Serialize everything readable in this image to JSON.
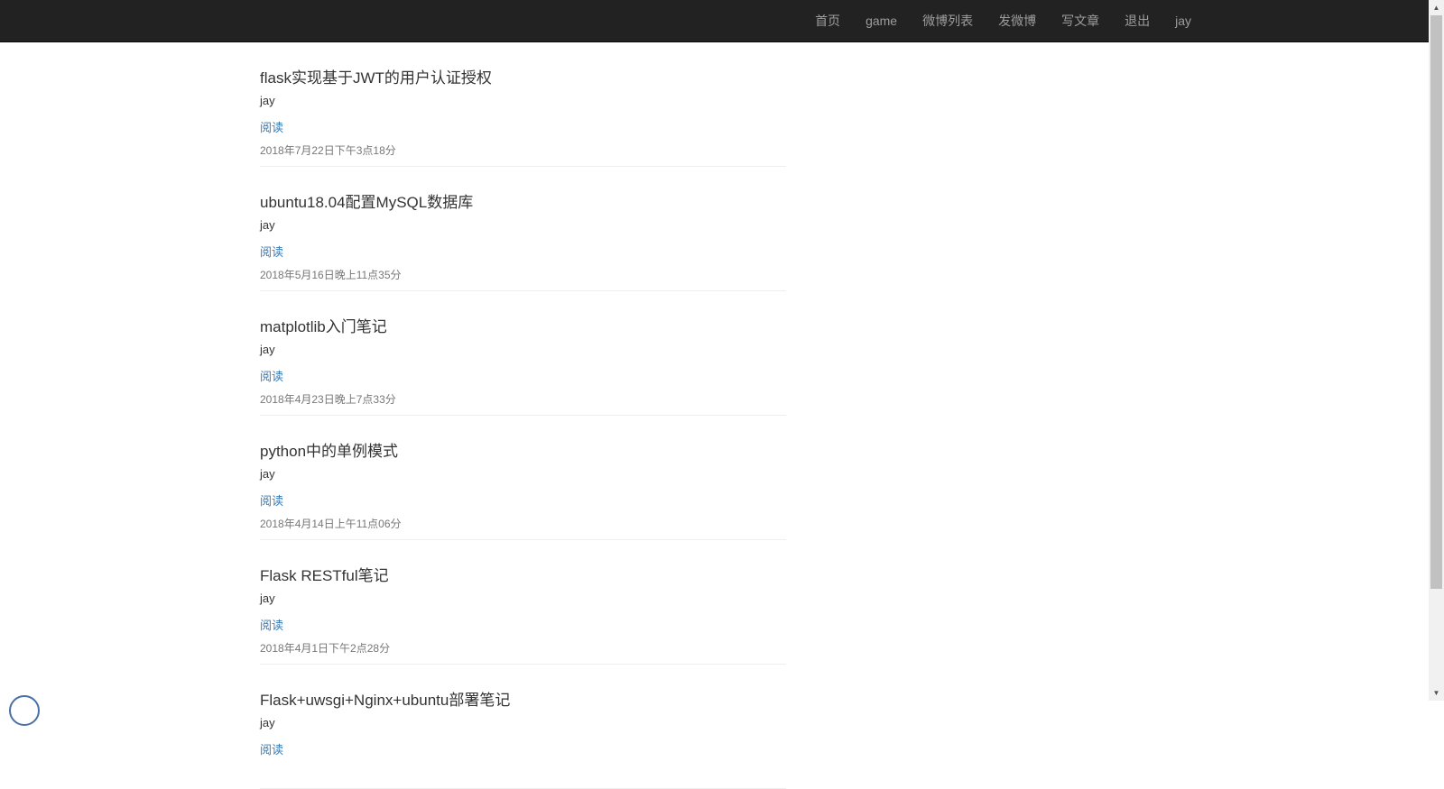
{
  "navbar": {
    "items": [
      {
        "label": "首页"
      },
      {
        "label": "game"
      },
      {
        "label": "微博列表"
      },
      {
        "label": "发微博"
      },
      {
        "label": "写文章"
      },
      {
        "label": "退出"
      },
      {
        "label": "jay"
      }
    ]
  },
  "posts": [
    {
      "title": "flask实现基于JWT的用户认证授权",
      "author": "jay",
      "read_label": "阅读",
      "date": "2018年7月22日下午3点18分"
    },
    {
      "title": "ubuntu18.04配置MySQL数据库",
      "author": "jay",
      "read_label": "阅读",
      "date": "2018年5月16日晚上11点35分"
    },
    {
      "title": "matplotlib入门笔记",
      "author": "jay",
      "read_label": "阅读",
      "date": "2018年4月23日晚上7点33分"
    },
    {
      "title": "python中的单例模式",
      "author": "jay",
      "read_label": "阅读",
      "date": "2018年4月14日上午11点06分"
    },
    {
      "title": "Flask RESTful笔记",
      "author": "jay",
      "read_label": "阅读",
      "date": "2018年4月1日下午2点28分"
    },
    {
      "title": "Flask+uwsgi+Nginx+ubuntu部署笔记",
      "author": "jay",
      "read_label": "阅读",
      "date": ""
    }
  ],
  "colors": {
    "navbar_bg": "#222222",
    "nav_link": "#9d9d9d",
    "link_blue": "#337ab7",
    "text": "#333333",
    "muted": "#777777"
  }
}
